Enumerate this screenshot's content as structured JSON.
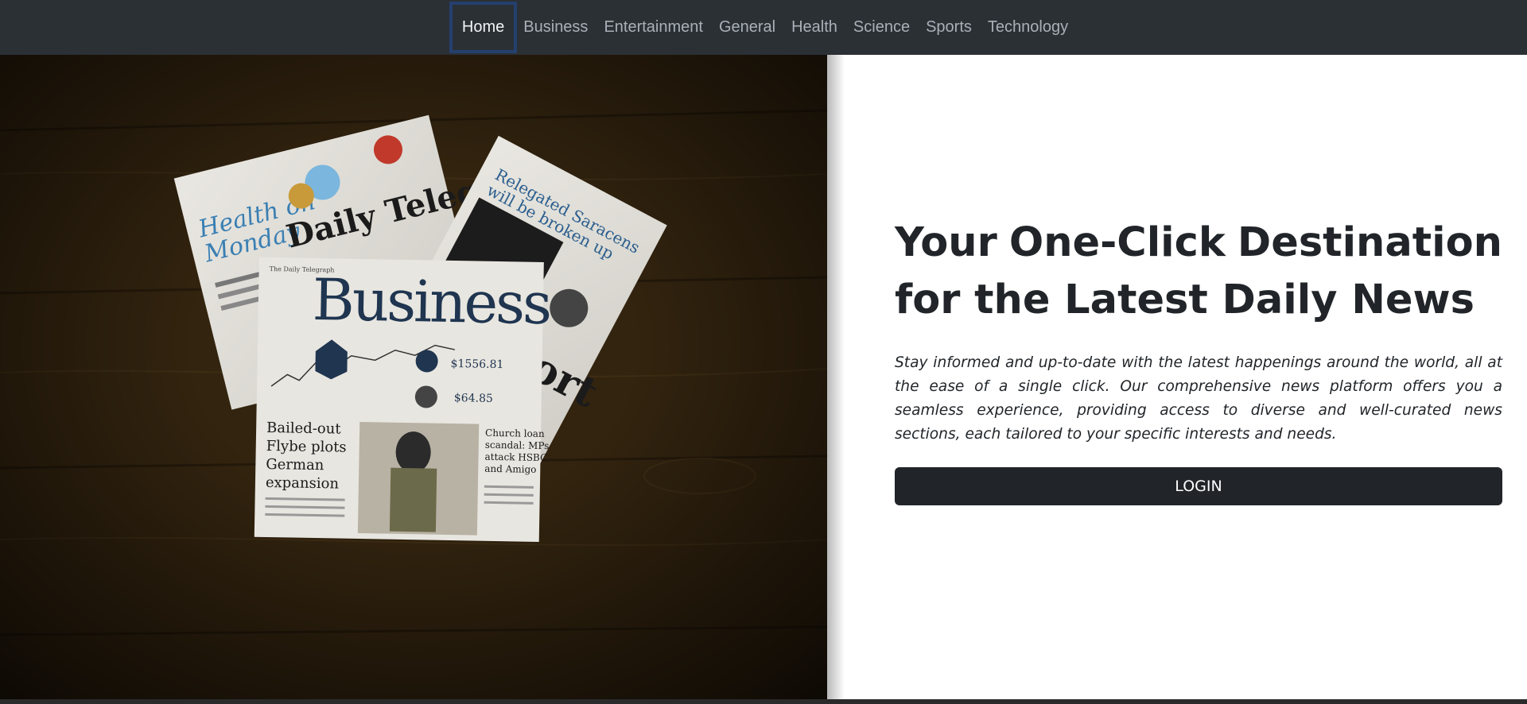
{
  "nav": {
    "items": [
      {
        "label": "Home",
        "active": true
      },
      {
        "label": "Business",
        "active": false
      },
      {
        "label": "Entertainment",
        "active": false
      },
      {
        "label": "General",
        "active": false
      },
      {
        "label": "Health",
        "active": false
      },
      {
        "label": "Science",
        "active": false
      },
      {
        "label": "Sports",
        "active": false
      },
      {
        "label": "Technology",
        "active": false
      }
    ]
  },
  "hero": {
    "newspaper_texts": {
      "health": "Health on Monday",
      "telegraph": "Daily Telegraph",
      "business": "Business",
      "sport": "Sport",
      "headline_left": "Bailed-out Flybe plots German expansion",
      "headline_right": "Church loan scandal: MPs attack HSBC and Amigo",
      "relegated": "Relegated Saracens will be broken up",
      "price1": "$1556.81",
      "price2": "$64.85"
    }
  },
  "main": {
    "headline_line1_words": [
      "Your",
      "One-Click",
      "Destination"
    ],
    "headline_line2": "for the Latest Daily News",
    "description": "Stay informed and up-to-date with the latest happenings around the world, all at the ease of a single click. Our comprehensive news platform offers you a seamless experience, providing access to diverse and well-curated news sections, each tailored to your specific interests and needs.",
    "login_label": "LOGIN"
  },
  "colors": {
    "navbar_bg": "#2b3035",
    "button_bg": "#212529",
    "active_outline": "#24406e"
  }
}
